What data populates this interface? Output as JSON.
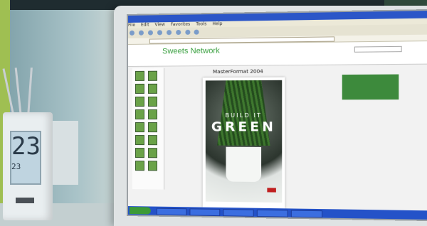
{
  "photo": {
    "subject": "Desktop computer monitor displaying a web browser with a magazine viewer"
  },
  "clock": {
    "big_digits": "23",
    "small_digits": "23"
  },
  "screen": {
    "browser_menu": [
      "File",
      "Edit",
      "View",
      "Favorites",
      "Tools",
      "Help"
    ],
    "site_logo_small": "",
    "site_name": "Sweets Network",
    "nav_items": [
      "",
      "",
      "",
      "",
      "",
      ""
    ],
    "viewer_title": "MasterFormat 2004",
    "promo_text": "",
    "cover": {
      "line1": "BUILD IT",
      "line2": "GREEN"
    }
  }
}
